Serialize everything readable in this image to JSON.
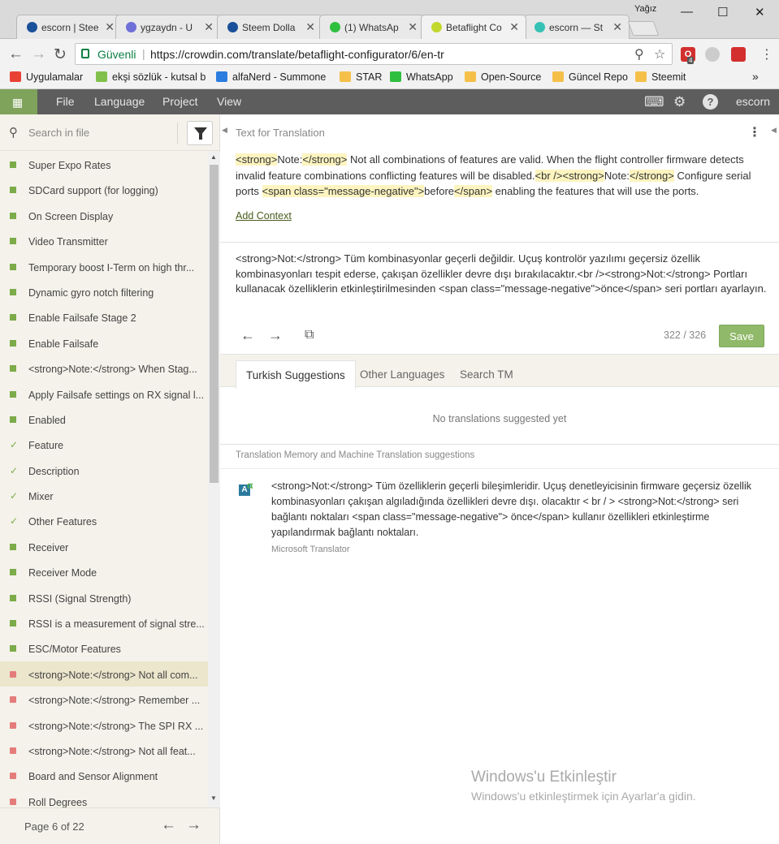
{
  "browser": {
    "window_user": "Yağız",
    "tabs": [
      {
        "title": "escorn | Stee",
        "favicon_color": "#1a5099"
      },
      {
        "title": "ygzaydn - U",
        "favicon_color": "#6f6fd8"
      },
      {
        "title": "Steem Dolla",
        "favicon_color": "#1a5099"
      },
      {
        "title": "(1) WhatsAp",
        "favicon_color": "#2fbf3f"
      },
      {
        "title": "Betaflight Co",
        "favicon_color": "#c3d82e"
      },
      {
        "title": "escorn — St",
        "favicon_color": "#36c1b5"
      }
    ],
    "secure_label": "Güvenli",
    "url": "https://crowdin.com/translate/betaflight-configurator/6/en-tr",
    "extension_badge": "4",
    "bookmarks": [
      {
        "label": "Uygulamalar",
        "icon_color": "#e94235"
      },
      {
        "label": "ekşi sözlük - kutsal b",
        "icon_color": "#81c14b"
      },
      {
        "label": "alfaNerd - Summone",
        "icon_color": "#2c7de0"
      },
      {
        "label": "STAR",
        "icon_color": "#f5c04a"
      },
      {
        "label": "WhatsApp",
        "icon_color": "#2fbf3f"
      },
      {
        "label": "Open-Source",
        "icon_color": "#f5c04a"
      },
      {
        "label": "Güncel Repo",
        "icon_color": "#f5c04a"
      },
      {
        "label": "Steemit",
        "icon_color": "#f5c04a"
      }
    ],
    "more_bookmarks": "»"
  },
  "app_nav": {
    "menus": [
      "File",
      "Language",
      "Project",
      "View"
    ],
    "username": "escorn",
    "accent_color": "#7fa35a"
  },
  "sidebar": {
    "search_placeholder": "Search in file",
    "items": [
      {
        "label": "Super Expo Rates",
        "status": "approved"
      },
      {
        "label": "SDCard support (for logging)",
        "status": "approved"
      },
      {
        "label": "On Screen Display",
        "status": "approved"
      },
      {
        "label": "Video Transmitter",
        "status": "approved"
      },
      {
        "label": "Temporary boost I-Term on high thr...",
        "status": "approved"
      },
      {
        "label": "Dynamic gyro notch filtering",
        "status": "approved"
      },
      {
        "label": "Enable Failsafe Stage 2",
        "status": "approved"
      },
      {
        "label": "Enable Failsafe",
        "status": "approved"
      },
      {
        "label": "<strong>Note:</strong> When Stag...",
        "status": "approved"
      },
      {
        "label": "Apply Failsafe settings on RX signal l...",
        "status": "approved"
      },
      {
        "label": "Enabled",
        "status": "approved"
      },
      {
        "label": "Feature",
        "status": "checked"
      },
      {
        "label": "Description",
        "status": "checked"
      },
      {
        "label": "Mixer",
        "status": "checked"
      },
      {
        "label": "Other Features",
        "status": "checked"
      },
      {
        "label": "Receiver",
        "status": "approved"
      },
      {
        "label": "Receiver Mode",
        "status": "approved"
      },
      {
        "label": "RSSI (Signal Strength)",
        "status": "approved"
      },
      {
        "label": "RSSI is a measurement of signal stre...",
        "status": "approved"
      },
      {
        "label": "ESC/Motor Features",
        "status": "approved"
      },
      {
        "label": "<strong>Note:</strong> Not all com...",
        "status": "untranslated",
        "selected": true
      },
      {
        "label": "<strong>Note:</strong> Remember ...",
        "status": "untranslated"
      },
      {
        "label": "<strong>Note:</strong> The SPI RX ...",
        "status": "untranslated"
      },
      {
        "label": "<strong>Note:</strong> Not all feat...",
        "status": "untranslated"
      },
      {
        "label": "Board and Sensor Alignment",
        "status": "untranslated"
      },
      {
        "label": "Roll Degrees",
        "status": "untranslated"
      }
    ],
    "page_label": "Page 6 of 22"
  },
  "editor": {
    "source_header": "Text for Translation",
    "source_segments": [
      {
        "t": "<strong>",
        "tag": true
      },
      {
        "t": "Note:",
        "tag": false
      },
      {
        "t": "</strong>",
        "tag": true
      },
      {
        "t": " Not all combinations of features are valid.  When the flight controller firmware detects invalid feature combinations conflicting features will be disabled.",
        "tag": false
      },
      {
        "t": "<br />",
        "tag": true
      },
      {
        "t": "<strong>",
        "tag": true
      },
      {
        "t": "Note:",
        "tag": false
      },
      {
        "t": "</strong>",
        "tag": true
      },
      {
        "t": " Configure serial ports ",
        "tag": false
      },
      {
        "t": "<span class=\"message-negative\">",
        "tag": true
      },
      {
        "t": "before",
        "tag": false
      },
      {
        "t": "</span>",
        "tag": true
      },
      {
        "t": " enabling the features that will use the ports.",
        "tag": false
      }
    ],
    "add_context": "Add Context",
    "translation": "<strong>Not:</strong> Tüm kombinasyonlar geçerli değildir. Uçuş kontrolör yazılımı geçersiz özellik kombinasyonları tespit ederse, çakışan özellikler devre dışı bırakılacaktır.<br /><strong>Not:</strong> Portları kullanacak özelliklerin etkinleştirilmesinden <span class=\"message-negative\">önce</span> seri portları ayarlayın.",
    "counter": "322 / 326",
    "save_label": "Save",
    "save_color": "#90b96a"
  },
  "suggestions": {
    "tabs": [
      "Turkish Suggestions",
      "Other Languages",
      "Search TM"
    ],
    "empty_text": "No translations suggested yet",
    "tm_header": "Translation Memory and Machine Translation suggestions",
    "mt_text": "<strong>Not:</strong> Tüm özelliklerin geçerli bileşimleridir.  Uçuş denetleyicisinin firmware geçersiz özellik kombinasyonları çakışan algıladığında özellikleri devre dışı. olacaktır < br / > <strong>Not:</strong> seri bağlantı noktaları <span class=\"message-negative\"> önce</span> kullanır özellikleri etkinleştirme yapılandırmak bağlantı noktaları.",
    "mt_source": "Microsoft Translator"
  },
  "watermark": {
    "title": "Windows'u Etkinleştir",
    "subtitle": "Windows'u etkinleştirmek için Ayarlar'a gidin."
  }
}
